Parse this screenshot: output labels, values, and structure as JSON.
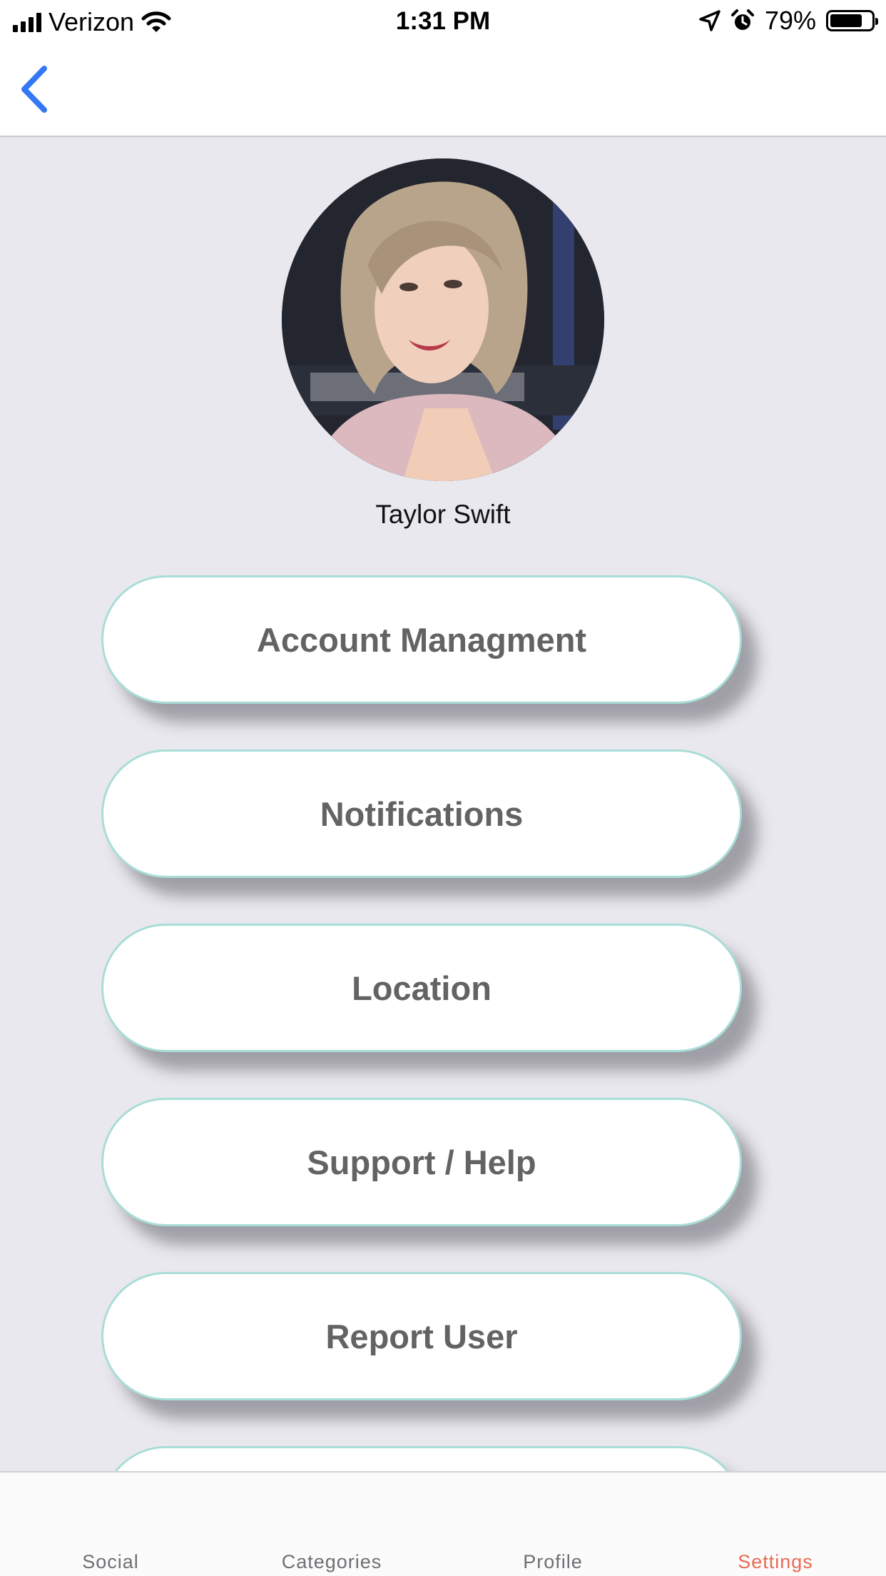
{
  "status_bar": {
    "carrier": "Verizon",
    "time": "1:31 PM",
    "battery": "79%",
    "battery_level": 0.79,
    "icons": [
      "signal-icon",
      "wifi-icon",
      "location-arrow-icon",
      "alarm-icon",
      "battery-icon"
    ]
  },
  "nav": {
    "back_icon": "chevron-left-icon",
    "accent_color": "#3478f6"
  },
  "profile": {
    "name": "Taylor Swift"
  },
  "menu": {
    "items": [
      {
        "label": "Account Managment"
      },
      {
        "label": "Notifications"
      },
      {
        "label": "Location"
      },
      {
        "label": "Support / Help"
      },
      {
        "label": "Report User"
      }
    ]
  },
  "tabs": {
    "items": [
      {
        "label": "Social"
      },
      {
        "label": "Categories"
      },
      {
        "label": "Profile"
      },
      {
        "label": "Settings",
        "active": true
      }
    ],
    "active_color": "#ea6a53"
  }
}
